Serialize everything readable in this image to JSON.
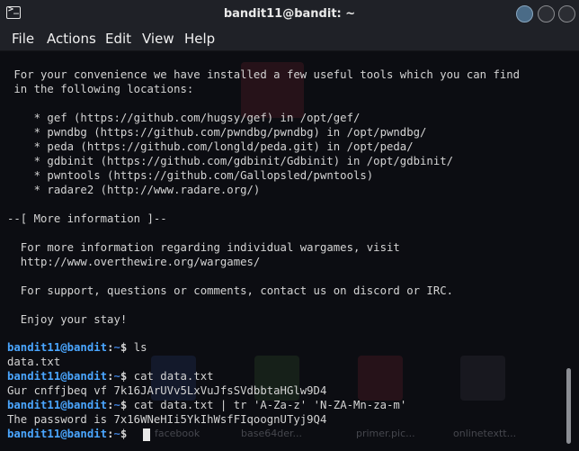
{
  "window": {
    "title": "bandit11@bandit: ~",
    "controls": [
      "minimize",
      "maximize",
      "close"
    ]
  },
  "menu": {
    "file": "File",
    "actions": "Actions",
    "edit": "Edit",
    "view": "View",
    "help": "Help"
  },
  "terminal": {
    "motd": [
      " For your convenience we have installed a few useful tools which you can find",
      " in the following locations:",
      "",
      "    * gef (https://github.com/hugsy/gef) in /opt/gef/",
      "    * pwndbg (https://github.com/pwndbg/pwndbg) in /opt/pwndbg/",
      "    * peda (https://github.com/longld/peda.git) in /opt/peda/",
      "    * gdbinit (https://github.com/gdbinit/Gdbinit) in /opt/gdbinit/",
      "    * pwntools (https://github.com/Gallopsled/pwntools)",
      "    * radare2 (http://www.radare.org/)",
      "",
      "--[ More information ]--",
      "",
      "  For more information regarding individual wargames, visit",
      "  http://www.overthewire.org/wargames/",
      "",
      "  For support, questions or comments, contact us on discord or IRC.",
      "",
      "  Enjoy your stay!"
    ],
    "prompt": {
      "user": "bandit11@bandit",
      "separator": ":",
      "path": "~",
      "symbol": "$ "
    },
    "session": [
      {
        "command": "ls",
        "output": "data.txt"
      },
      {
        "command": "cat data.txt",
        "output": "Gur cnffjbeq vf 7k16JArUVv5LxVuJfsSVdbbtaHGlw9D4"
      },
      {
        "command": "cat data.txt | tr 'A-Za-z' 'N-ZA-Mn-za-m'",
        "output": "The password is 7x16WNeHIi5YkIhWsfFIqoognUTyj9Q4"
      },
      {
        "command": "",
        "output": ""
      }
    ]
  },
  "desktop_ghost_labels": [
    "facebook",
    "base64der...",
    "primer.pic...",
    "onlinetextt..."
  ],
  "colors": {
    "titlebar": "#1f2127",
    "terminal_bg": "#0c0d12",
    "text": "#d4d4d4",
    "prompt_user": "#4aa6ff",
    "prompt_path": "#3f7ed6",
    "minimize_button": "#4a6b87"
  }
}
